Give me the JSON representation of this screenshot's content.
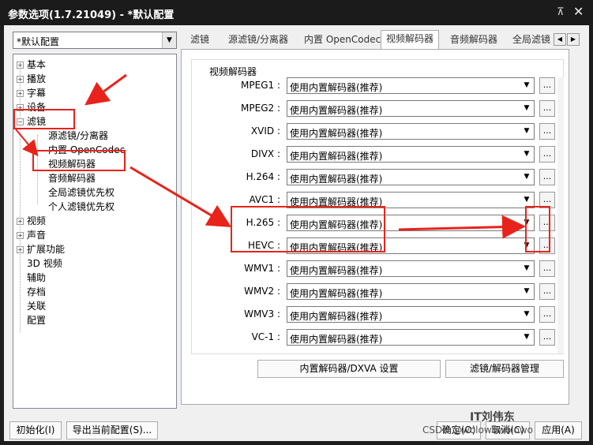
{
  "window": {
    "title": "参数选项(1.7.21049) - *默认配置",
    "pin_glyph": "⊼",
    "close_glyph": "✕"
  },
  "preset": {
    "value": "*默认配置",
    "arrow": "▼"
  },
  "tree": {
    "items": [
      {
        "label": "基本",
        "toggle": "+"
      },
      {
        "label": "播放",
        "toggle": "+"
      },
      {
        "label": "字幕",
        "toggle": "+"
      },
      {
        "label": "设备",
        "toggle": "+"
      },
      {
        "label": "滤镜",
        "toggle": "−"
      },
      {
        "label": "源滤镜/分离器"
      },
      {
        "label": "内置 OpenCodec"
      },
      {
        "label": "视频解码器"
      },
      {
        "label": "音频解码器"
      },
      {
        "label": "全局滤镜优先权"
      },
      {
        "label": "个人滤镜优先权"
      },
      {
        "label": "视频",
        "toggle": "+"
      },
      {
        "label": "声音",
        "toggle": "+"
      },
      {
        "label": "扩展功能",
        "toggle": "+"
      },
      {
        "label": "3D 视频"
      },
      {
        "label": "辅助"
      },
      {
        "label": "存档"
      },
      {
        "label": "关联"
      },
      {
        "label": "配置"
      }
    ]
  },
  "tabs": {
    "items": [
      "滤镜",
      "源滤镜/分离器",
      "内置 OpenCodec",
      "视频解码器",
      "音频解码器",
      "全局滤镜"
    ],
    "active": "视频解码器",
    "scroll_left": "◀",
    "scroll_right": "▶"
  },
  "video_decoder": {
    "group_title": "视频解码器",
    "rows": [
      {
        "codec": "MPEG1 :",
        "value": "使用内置解码器(推荐)"
      },
      {
        "codec": "MPEG2 :",
        "value": "使用内置解码器(推荐)"
      },
      {
        "codec": "XVID :",
        "value": "使用内置解码器(推荐)"
      },
      {
        "codec": "DIVX :",
        "value": "使用内置解码器(推荐)"
      },
      {
        "codec": "H.264 :",
        "value": "使用内置解码器(推荐)"
      },
      {
        "codec": "AVC1 :",
        "value": "使用内置解码器(推荐)"
      },
      {
        "codec": "H.265 :",
        "value": "使用内置解码器(推荐)"
      },
      {
        "codec": "HEVC :",
        "value": "使用内置解码器(推荐)"
      },
      {
        "codec": "WMV1 :",
        "value": "使用内置解码器(推荐)"
      },
      {
        "codec": "WMV2 :",
        "value": "使用内置解码器(推荐)"
      },
      {
        "codec": "WMV3 :",
        "value": "使用内置解码器(推荐)"
      },
      {
        "codec": "VC-1 :",
        "value": "使用内置解码器(推荐)"
      }
    ],
    "dots_label": "...",
    "select_arrow": "▼",
    "builtin_dxva_button": "内置解码器/DXVA 设置",
    "filter_manage_button": "滤镜/解码器管理"
  },
  "bottom": {
    "init_button": "初始化(I)",
    "export_button": "导出当前配置(S)...",
    "ok_button": "确定(O)",
    "cancel_button": "取消(C)",
    "apply_button": "应用(A)"
  },
  "watermark": {
    "brand": "IT刘伟东",
    "csdn": "CSDN @wolowowolowo"
  },
  "annotation_color": "#e8231b"
}
